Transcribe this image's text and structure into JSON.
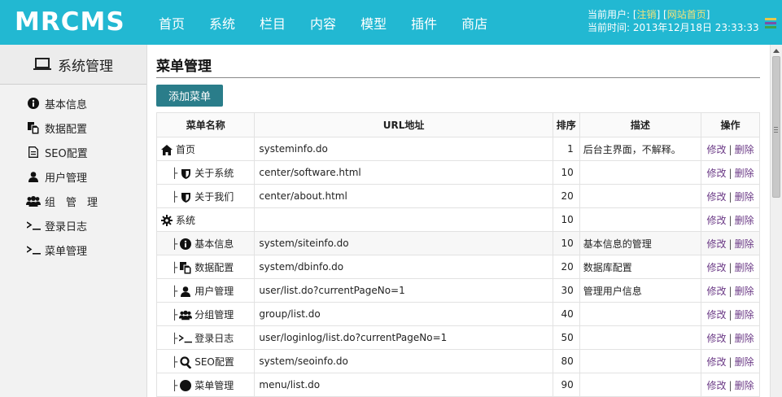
{
  "header": {
    "logo": "MRCMS",
    "nav": [
      "首页",
      "系统",
      "栏目",
      "内容",
      "模型",
      "插件",
      "商店"
    ],
    "user_label": "当前用户:",
    "logout": "注销",
    "site_home": "网站首页",
    "time_label": "当前时间:",
    "time_value": "2013年12月18日 23:33:33",
    "bg_color": "#22b8d2",
    "menu_colors": [
      "#e8c84a",
      "#7b4fa8",
      "#3fa34d"
    ]
  },
  "sidebar": {
    "title": "系统管理",
    "items": [
      {
        "label": "基本信息",
        "icon": "info-circle-icon"
      },
      {
        "label": "数据配置",
        "icon": "copy-icon"
      },
      {
        "label": "SEO配置",
        "icon": "file-text-icon"
      },
      {
        "label": "用户管理",
        "icon": "user-icon"
      },
      {
        "label": "组　管　理",
        "icon": "users-icon"
      },
      {
        "label": "登录日志",
        "icon": "terminal-icon"
      },
      {
        "label": "菜单管理",
        "icon": "terminal-icon"
      }
    ]
  },
  "main": {
    "title": "菜单管理",
    "add_button": "添加菜单",
    "columns": [
      "菜单名称",
      "URL地址",
      "排序",
      "描述",
      "操作"
    ],
    "edit_label": "修改",
    "delete_label": "删除",
    "op_sep": "|",
    "rows": [
      {
        "name": "首页",
        "icon": "home-icon",
        "child": false,
        "url": "systeminfo.do",
        "sort": "1",
        "desc": "后台主界面，不解释。"
      },
      {
        "name": "关于系统",
        "icon": "shield-icon",
        "child": true,
        "url": "center/software.html",
        "sort": "10",
        "desc": ""
      },
      {
        "name": "关于我们",
        "icon": "shield-icon",
        "child": true,
        "url": "center/about.html",
        "sort": "20",
        "desc": ""
      },
      {
        "name": "系统",
        "icon": "gear-icon",
        "child": false,
        "url": "",
        "sort": "10",
        "desc": ""
      },
      {
        "name": "基本信息",
        "icon": "info-circle-icon",
        "child": true,
        "url": "system/siteinfo.do",
        "sort": "10",
        "desc": "基本信息的管理"
      },
      {
        "name": "数据配置",
        "icon": "copy-icon",
        "child": true,
        "url": "system/dbinfo.do",
        "sort": "20",
        "desc": "数据库配置"
      },
      {
        "name": "用户管理",
        "icon": "user-icon",
        "child": true,
        "url": "user/list.do?currentPageNo=1",
        "sort": "30",
        "desc": "管理用户信息"
      },
      {
        "name": "分组管理",
        "icon": "users-icon",
        "child": true,
        "url": "group/list.do",
        "sort": "40",
        "desc": ""
      },
      {
        "name": "登录日志",
        "icon": "terminal-icon",
        "child": true,
        "url": "user/loginlog/list.do?currentPageNo=1",
        "sort": "50",
        "desc": ""
      },
      {
        "name": "SEO配置",
        "icon": "search-icon",
        "child": true,
        "url": "system/seoinfo.do",
        "sort": "80",
        "desc": ""
      },
      {
        "name": "菜单管理",
        "icon": "circle-icon",
        "child": true,
        "url": "menu/list.do",
        "sort": "90",
        "desc": ""
      }
    ]
  }
}
